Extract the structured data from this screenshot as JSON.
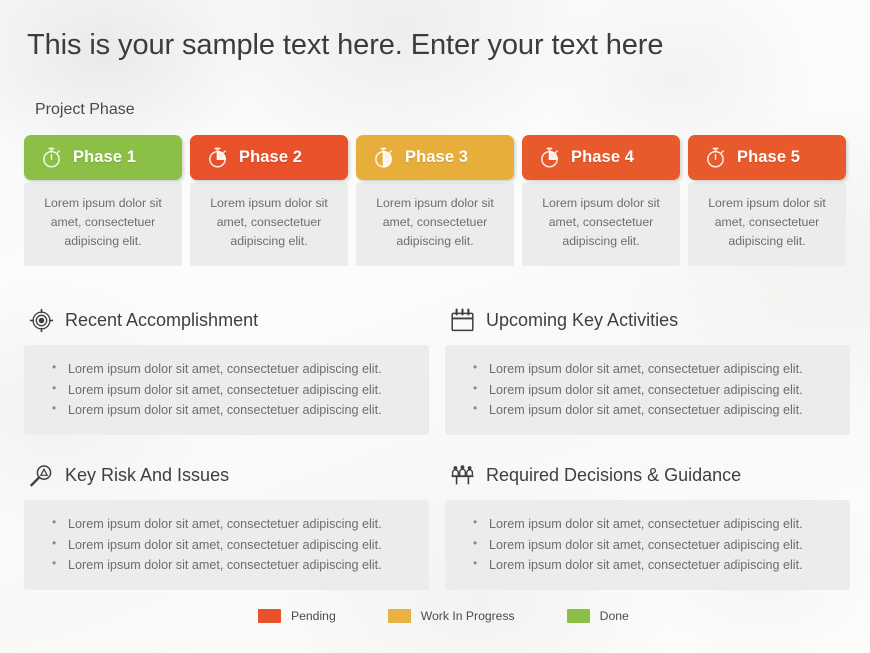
{
  "slide": {
    "title": "This is your sample text here. Enter your text here",
    "phase_section_label": "Project Phase"
  },
  "phases": [
    {
      "name": "Phase 1",
      "icon": "stopwatch-icon",
      "color": "#8CBF46",
      "status": "Done",
      "fill_level": 0,
      "description": "Lorem ipsum dolor sit amet, consectetuer adipiscing elit."
    },
    {
      "name": "Phase 2",
      "icon": "stopwatch-icon",
      "color": "#E8512A",
      "status": "Pending",
      "fill_level": 25,
      "description": "Lorem ipsum dolor sit amet, consectetuer adipiscing elit."
    },
    {
      "name": "Phase 3",
      "icon": "stopwatch-icon",
      "color": "#E8AE3C",
      "status": "Work In Progress",
      "fill_level": 50,
      "description": "Lorem ipsum dolor sit amet, consectetuer adipiscing elit."
    },
    {
      "name": "Phase 4",
      "icon": "stopwatch-icon",
      "color": "#E85A2B",
      "status": "Pending",
      "fill_level": 25,
      "description": "Lorem ipsum dolor sit amet, consectetuer adipiscing elit."
    },
    {
      "name": "Phase 5",
      "icon": "stopwatch-icon",
      "color": "#E85A2B",
      "status": "Pending",
      "fill_level": 0,
      "description": "Lorem ipsum dolor sit amet, consectetuer adipiscing elit."
    }
  ],
  "sections": [
    {
      "title": "Recent Accomplishment",
      "icon": "target-crosshair-icon",
      "bullets": [
        "Lorem ipsum dolor sit amet, consectetuer adipiscing elit.",
        "Lorem ipsum dolor sit amet, consectetuer adipiscing elit.",
        "Lorem ipsum dolor sit amet, consectetuer adipiscing elit."
      ]
    },
    {
      "title": "Upcoming Key Activities",
      "icon": "calendar-icon",
      "bullets": [
        "Lorem ipsum dolor sit amet, consectetuer adipiscing elit.",
        "Lorem ipsum dolor sit amet, consectetuer adipiscing elit.",
        "Lorem ipsum dolor sit amet, consectetuer adipiscing elit."
      ]
    },
    {
      "title": "Key Risk And Issues",
      "icon": "magnifier-warning-icon",
      "bullets": [
        "Lorem ipsum dolor sit amet, consectetuer adipiscing elit.",
        "Lorem ipsum dolor sit amet, consectetuer adipiscing elit.",
        "Lorem ipsum dolor sit amet, consectetuer adipiscing elit."
      ]
    },
    {
      "title": "Required Decisions & Guidance",
      "icon": "meeting-table-icon",
      "bullets": [
        "Lorem ipsum dolor sit amet, consectetuer adipiscing elit.",
        "Lorem ipsum dolor sit amet, consectetuer adipiscing elit.",
        "Lorem ipsum dolor sit amet, consectetuer adipiscing elit."
      ]
    }
  ],
  "legend": [
    {
      "label": "Pending",
      "color": "#E8532B"
    },
    {
      "label": "Work In Progress",
      "color": "#E8B141"
    },
    {
      "label": "Done",
      "color": "#8CBF46"
    }
  ]
}
